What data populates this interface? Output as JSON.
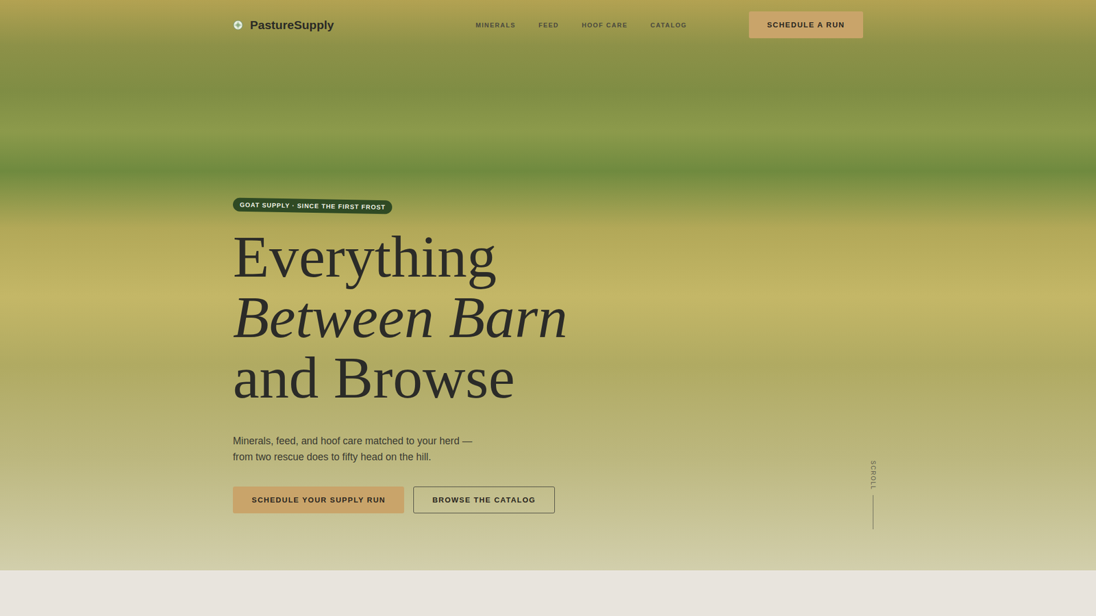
{
  "nav": {
    "logo": "PastureSupply",
    "links": [
      {
        "label": "MINERALS"
      },
      {
        "label": "FEED"
      },
      {
        "label": "HOOF CARE"
      },
      {
        "label": "CATALOG"
      }
    ],
    "cta": "SCHEDULE A RUN"
  },
  "hero": {
    "badge": "GOAT SUPPLY · SINCE THE FIRST FROST",
    "heading": [
      {
        "text": "Everything",
        "kind": "roman"
      },
      {
        "text": "Between Barn",
        "kind": "italic"
      },
      {
        "text": "and Browse",
        "kind": "roman"
      }
    ],
    "subtitle": "Minerals, feed, and hoof care matched to your herd — from two rescue does to fifty head on the hill.",
    "buttons": [
      {
        "label": "SCHEDULE YOUR SUPPLY RUN",
        "kind": "primary"
      },
      {
        "label": "BROWSE THE CATALOG",
        "kind": "outline"
      }
    ],
    "scroll": "SCROLL"
  }
}
